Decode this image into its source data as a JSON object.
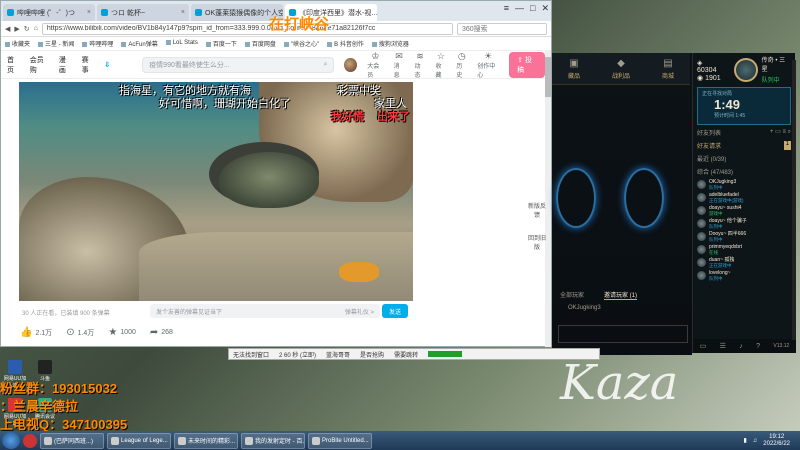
{
  "browser": {
    "tabs": [
      {
        "label": "哔哩哔哩 (゜-゜)つ"
      },
      {
        "label": "つロ 乾杯~"
      },
      {
        "label": "OK蓬莱猿猴偶像的个人空间"
      },
      {
        "label": "《印度洋西里》潜水-视..."
      }
    ],
    "window_controls": [
      "≡",
      "—",
      "□",
      "✕"
    ],
    "url": "https://www.bilibili.com/video/BV1b84y147p9?spm_id_from=333.999.0.0&vd_source=8a6ae71a82126f7cc",
    "search_engine_placeholder": "360搜索",
    "bookmarks": [
      "收藏夹",
      "三星 - 新闻",
      "哔哩哔哩",
      "AcFun弹幕",
      "LoL Stats",
      "百度一下",
      "百度网盘",
      "\"峡谷之心\"",
      "B 抖音创作",
      "搜狗浏览器"
    ]
  },
  "overlay_title": "在打峡谷",
  "bili": {
    "nav": [
      "首页",
      "会员购",
      "漫画",
      "赛事"
    ],
    "search_placeholder": "疫情990看最终使生么分...",
    "header_icons": [
      {
        "icon": "crown-icon",
        "label": "大会员"
      },
      {
        "icon": "message-icon",
        "label": "消息"
      },
      {
        "icon": "wind-icon",
        "label": "动态"
      },
      {
        "icon": "star-icon",
        "label": "收藏"
      },
      {
        "icon": "history-icon",
        "label": "历史"
      },
      {
        "icon": "bulb-icon",
        "label": "创作中心"
      }
    ],
    "upload_label": "投稿",
    "danmaku": [
      "指海星，有它的地方就有海",
      "好可惜啊，珊瑚开始白化了",
      "彩票中奖",
      "家里人",
      "我好慌",
      "出来了"
    ],
    "video_stats": "30 人正在看，已装填 900 条弹幕",
    "danmaku_placeholder": "发个友善的弹幕见证当下",
    "danmaku_etiquette": "弹幕礼仪 >",
    "send_label": "发送",
    "actions": [
      {
        "icon": "like-icon",
        "value": "2.1万"
      },
      {
        "icon": "coin-icon",
        "value": "1.4万"
      },
      {
        "icon": "favorite-icon",
        "value": "1000"
      },
      {
        "icon": "share-icon",
        "value": "268"
      }
    ],
    "side_nav": [
      "新版反馈",
      "回到旧版"
    ]
  },
  "lol": {
    "top_nav": [
      {
        "icon": "bag-icon",
        "label": "藏品"
      },
      {
        "icon": "loot-icon",
        "label": "战利品"
      },
      {
        "icon": "store-icon",
        "label": "商城"
      }
    ],
    "blue_essence": "60304",
    "rp": "1901",
    "summoner_name": "传奇 • 三星",
    "summoner_status": "队列中",
    "queue_label": "正在寻找对局",
    "queue_time": "1:49",
    "queue_sub": "预计时间 1:45",
    "social_label": "好友列表",
    "requests_label": "好友请求",
    "requests_count": "1",
    "groups": [
      "最近 (0/39)",
      "综合 (47/483)"
    ],
    "friends": [
      {
        "name": "OKJugking3",
        "status": "队列中",
        "game": true
      },
      {
        "name": "adelbluefadel",
        "status": "正在游戏中(游戏)",
        "game": true
      },
      {
        "name": "doayu~ sushi4",
        "status": "游戏中",
        "game": false
      },
      {
        "name": "doayu~ 他个骗子",
        "status": "队列中",
        "game": true
      },
      {
        "name": "Dooyu~ 四半666",
        "status": "队列中",
        "game": true
      },
      {
        "name": "primmyeqdxbrt",
        "status": "在线",
        "game": false
      },
      {
        "name": "duan~ 孤独",
        "status": "正在游戏中",
        "game": true
      },
      {
        "name": "lovelong~",
        "status": "队列中",
        "game": true
      }
    ],
    "footer_tabs": [
      "全部玩家",
      "邀请玩家 (1)"
    ],
    "footer_item": "OKJugking3",
    "version": "V13.12"
  },
  "under_bar": {
    "items": [
      "无法找到窗口",
      "2 60 秒 (立即)",
      "蓝海哥哥",
      "是否抢购",
      "需要跳转"
    ]
  },
  "stream": {
    "fan_group": "粉丝群：193015032",
    "nickname": "：兰晨辛德拉",
    "qq": "上电视Q：347100395"
  },
  "desktop_icons": [
    "网易UU加速",
    "斗鱼",
    "网易UU加速",
    "腾讯会议"
  ],
  "watermark": "Kaza",
  "taskbar": {
    "tasks": [
      "(巴萨同西班...)",
      "League of Lege...",
      "未来时间的精彩...",
      "我的发射定时 - 百...",
      "ProBite Untitled..."
    ],
    "clock_time": "19:12",
    "clock_date": "2022/6/22"
  }
}
